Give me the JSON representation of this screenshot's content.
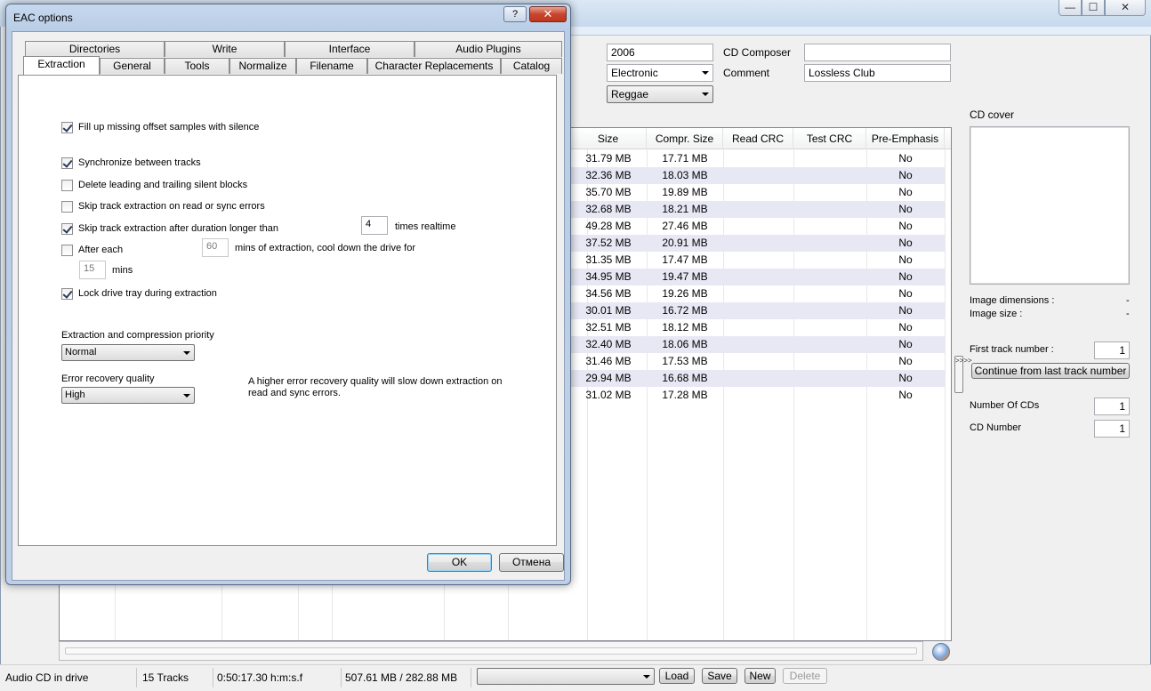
{
  "main": {
    "caption_buttons": {
      "minimize": "—",
      "maximize": "☐",
      "close": "✕"
    },
    "fields": {
      "year": "2006",
      "genre": "Electronic",
      "freedb_genre": "Reggae",
      "cd_composer_label": "CD Composer",
      "cd_composer_value": "",
      "comment_label": "Comment",
      "comment_value": "Lossless Club"
    },
    "table": {
      "columns": [
        "Size",
        "Compr. Size",
        "Read CRC",
        "Test CRC",
        "Pre-Emphasis"
      ],
      "rows": [
        {
          "size": "31.79 MB",
          "compr": "17.71 MB",
          "read_crc": "",
          "test_crc": "",
          "pre_emphasis": "No"
        },
        {
          "size": "32.36 MB",
          "compr": "18.03 MB",
          "read_crc": "",
          "test_crc": "",
          "pre_emphasis": "No"
        },
        {
          "size": "35.70 MB",
          "compr": "19.89 MB",
          "read_crc": "",
          "test_crc": "",
          "pre_emphasis": "No"
        },
        {
          "size": "32.68 MB",
          "compr": "18.21 MB",
          "read_crc": "",
          "test_crc": "",
          "pre_emphasis": "No"
        },
        {
          "size": "49.28 MB",
          "compr": "27.46 MB",
          "read_crc": "",
          "test_crc": "",
          "pre_emphasis": "No"
        },
        {
          "size": "37.52 MB",
          "compr": "20.91 MB",
          "read_crc": "",
          "test_crc": "",
          "pre_emphasis": "No"
        },
        {
          "size": "31.35 MB",
          "compr": "17.47 MB",
          "read_crc": "",
          "test_crc": "",
          "pre_emphasis": "No"
        },
        {
          "size": "34.95 MB",
          "compr": "19.47 MB",
          "read_crc": "",
          "test_crc": "",
          "pre_emphasis": "No"
        },
        {
          "size": "34.56 MB",
          "compr": "19.26 MB",
          "read_crc": "",
          "test_crc": "",
          "pre_emphasis": "No"
        },
        {
          "size": "30.01 MB",
          "compr": "16.72 MB",
          "read_crc": "",
          "test_crc": "",
          "pre_emphasis": "No"
        },
        {
          "size": "32.51 MB",
          "compr": "18.12 MB",
          "read_crc": "",
          "test_crc": "",
          "pre_emphasis": "No"
        },
        {
          "size": "32.40 MB",
          "compr": "18.06 MB",
          "read_crc": "",
          "test_crc": "",
          "pre_emphasis": "No"
        },
        {
          "size": "31.46 MB",
          "compr": "17.53 MB",
          "read_crc": "",
          "test_crc": "",
          "pre_emphasis": "No"
        },
        {
          "size": "29.94 MB",
          "compr": "16.68 MB",
          "read_crc": "",
          "test_crc": "",
          "pre_emphasis": "No"
        },
        {
          "size": "31.02 MB",
          "compr": "17.28 MB",
          "read_crc": "",
          "test_crc": "",
          "pre_emphasis": "No"
        }
      ]
    },
    "cover": {
      "label": "CD cover",
      "image_dimensions_label": "Image dimensions :",
      "image_dimensions_value": "-",
      "image_size_label": "Image size :",
      "image_size_value": "-"
    },
    "track_numbers": {
      "first_track_label": "First track number :",
      "first_track_value": "1",
      "continue_button": "Continue from last track number",
      "number_of_cds_label": "Number Of CDs",
      "number_of_cds_value": "1",
      "cd_number_label": "CD Number",
      "cd_number_value": "1"
    },
    "side_toggle": ">>>>"
  },
  "statusbar": {
    "drive_status": "Audio CD in drive",
    "tracks": "15 Tracks",
    "duration": "0:50:17.30 h:m:s.f",
    "size": "507.61 MB / 282.88 MB",
    "profile_select": "",
    "load": "Load",
    "save": "Save",
    "new": "New",
    "delete": "Delete"
  },
  "dialog": {
    "title": "EAC options",
    "help_glyph": "?",
    "close_glyph": "✕",
    "tabs_back": [
      "Directories",
      "Write",
      "Interface",
      "Audio Plugins"
    ],
    "tabs_front": [
      "Extraction",
      "General",
      "Tools",
      "Normalize",
      "Filename",
      "Character Replacements",
      "Catalog"
    ],
    "options": {
      "fill_offset": {
        "label": "Fill up missing offset samples with silence",
        "checked": true
      },
      "sync_tracks": {
        "label": "Synchronize between tracks",
        "checked": true
      },
      "delete_silent": {
        "label": "Delete leading and trailing silent blocks",
        "checked": false
      },
      "skip_errors": {
        "label": "Skip track extraction on read or sync errors",
        "checked": false
      },
      "skip_duration": {
        "label": "Skip track extraction after duration longer than",
        "checked": true,
        "value": "4",
        "suffix": "times realtime"
      },
      "cool_down": {
        "label": "After each",
        "checked": false,
        "value": "60",
        "middle": "mins of extraction, cool down the drive for",
        "value2": "15",
        "suffix": "mins"
      },
      "lock_tray": {
        "label": "Lock drive tray during extraction",
        "checked": true
      }
    },
    "priority_label": "Extraction and compression priority",
    "priority_value": "Normal",
    "error_recovery_label": "Error recovery quality",
    "error_recovery_value": "High",
    "error_recovery_note": "A higher error recovery quality will slow down extraction on read and sync errors.",
    "ok": "OK",
    "cancel": "Отмена"
  }
}
